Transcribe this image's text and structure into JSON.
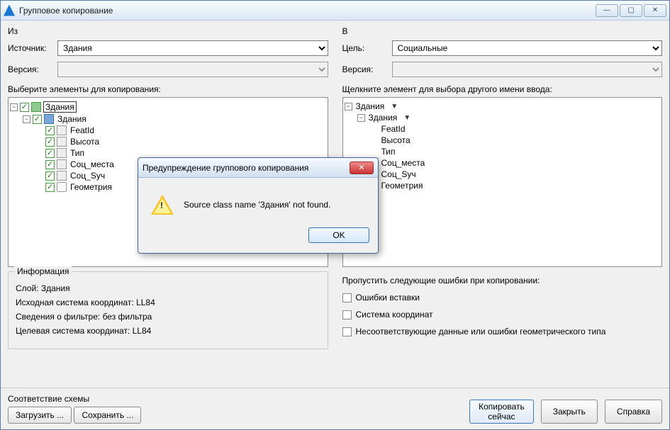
{
  "window": {
    "title": "Групповое копирование",
    "min": "—",
    "max": "▢",
    "close": "✕"
  },
  "left": {
    "header": "Из",
    "source_label": "Источник:",
    "source_value": "Здания",
    "version_label": "Версия:",
    "tree_label": "Выберите элементы для копирования:",
    "tree": {
      "root": "Здания",
      "class": "Здания",
      "props": [
        "FeatId",
        "Высота",
        "Тип",
        "Соц_места",
        "Соц_Sуч",
        "Геометрия"
      ]
    },
    "info": {
      "legend": "Информация",
      "layer": "Слой: Здания",
      "src_cs": "Исходная система координат: LL84",
      "filter": "Сведения о фильтре: без фильтра",
      "dst_cs": "Целевая система координат: LL84"
    }
  },
  "right": {
    "header": "В",
    "target_label": "Цель:",
    "target_value": "Социальные",
    "version_label": "Версия:",
    "tree_label": "Щелкните элемент для выбора другого имени ввода:",
    "tree": {
      "root": "Здания",
      "class": "Здания",
      "props": [
        "FeatId",
        "Высота",
        "Тип",
        "Соц_места",
        "Соц_Sуч",
        "Геометрия"
      ]
    },
    "skip": {
      "header": "Пропустить следующие ошибки при копировании:",
      "opt1": "Ошибки вставки",
      "opt2": "Система координат",
      "opt3": "Несоответствующие данные или ошибки геометрического типа"
    }
  },
  "footer": {
    "schema_label": "Соответствие схемы",
    "load": "Загрузить ...",
    "save": "Сохранить ...",
    "copy_now": "Копировать\nсейчас",
    "close": "Закрыть",
    "help": "Справка"
  },
  "modal": {
    "title": "Предупреждение группового копирования",
    "message": "Source class name 'Здания' not found.",
    "ok": "OK"
  }
}
